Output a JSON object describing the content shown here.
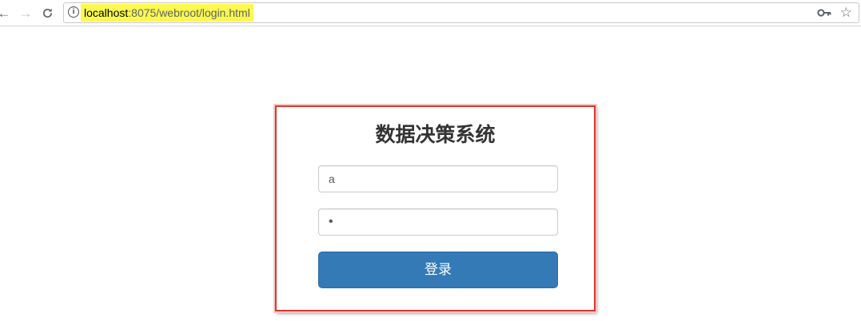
{
  "browser": {
    "back_icon": "back-arrow-icon",
    "forward_icon": "forward-arrow-icon",
    "reload_icon": "reload-icon",
    "url_host": "localhost",
    "url_rest": ":8075/webroot/login.html",
    "url_highlight_color": "#fbf850",
    "key_icon": "key-icon",
    "bookmark_icon": "star-icon"
  },
  "login": {
    "title": "数据决策系统",
    "username_value": "a",
    "password_value": "•",
    "submit_label": "登录",
    "frame_color": "#d9382f",
    "button_color": "#337ab7"
  }
}
